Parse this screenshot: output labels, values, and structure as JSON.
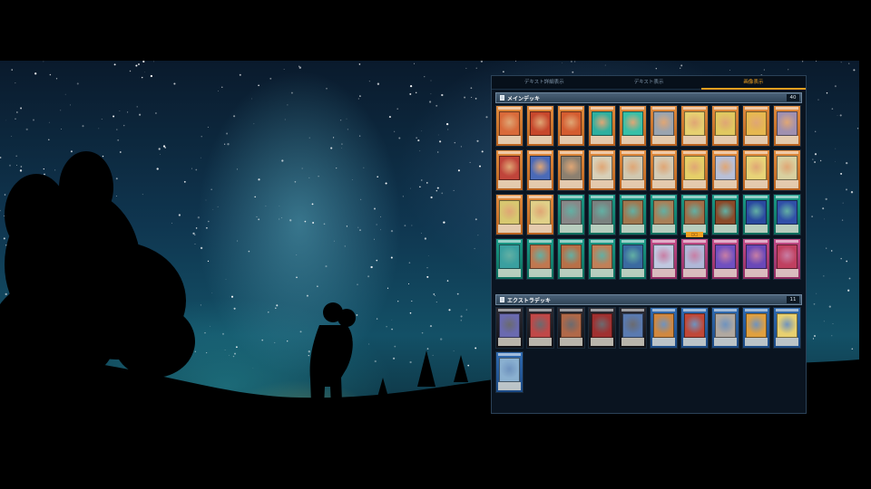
{
  "tabs": [
    {
      "label": "デキスト詳細表示",
      "active": false
    },
    {
      "label": "デキスト表示",
      "active": false
    },
    {
      "label": "画像表示",
      "active": true
    }
  ],
  "main_deck": {
    "title": "メインデッキ",
    "count": "40",
    "cards": [
      {
        "type": "effect",
        "art": "#d96a3a"
      },
      {
        "type": "effect",
        "art": "#c7472c"
      },
      {
        "type": "effect",
        "art": "#d45c30"
      },
      {
        "type": "effect",
        "art": "#2fb0a0"
      },
      {
        "type": "effect",
        "art": "#36c0a8"
      },
      {
        "type": "effect",
        "art": "#9aa4b0"
      },
      {
        "type": "effect",
        "art": "#e6d070"
      },
      {
        "type": "effect",
        "art": "#e0c860"
      },
      {
        "type": "effect",
        "art": "#e6b850"
      },
      {
        "type": "effect",
        "art": "#a090b0"
      },
      {
        "type": "effect",
        "art": "#c0443a"
      },
      {
        "type": "effect",
        "art": "#4a6ab8"
      },
      {
        "type": "effect",
        "art": "#8c8070"
      },
      {
        "type": "effect",
        "art": "#d8d0b8"
      },
      {
        "type": "effect",
        "art": "#d0c8b0"
      },
      {
        "type": "effect",
        "art": "#d4cbb5"
      },
      {
        "type": "effect",
        "art": "#e6d068"
      },
      {
        "type": "effect",
        "art": "#b8c0d8"
      },
      {
        "type": "effect",
        "art": "#e8d478"
      },
      {
        "type": "effect",
        "art": "#d8d0a0"
      },
      {
        "type": "effect",
        "art": "#d8c870"
      },
      {
        "type": "effect",
        "art": "#e0d088"
      },
      {
        "type": "spell",
        "art": "#888888"
      },
      {
        "type": "spell",
        "art": "#7a8280"
      },
      {
        "type": "spell",
        "art": "#a07850"
      },
      {
        "type": "spell",
        "art": "#a88058"
      },
      {
        "type": "spell",
        "art": "#a06e48",
        "badge": "□□"
      },
      {
        "type": "spell",
        "art": "#8a4a2a"
      },
      {
        "type": "spell",
        "art": "#2a4aa0"
      },
      {
        "type": "spell",
        "art": "#3050a8"
      },
      {
        "type": "spell",
        "art": "#3aa0a0"
      },
      {
        "type": "spell",
        "art": "#c07850"
      },
      {
        "type": "spell",
        "art": "#b87048"
      },
      {
        "type": "spell",
        "art": "#c08058"
      },
      {
        "type": "spell",
        "art": "#3a6aa0"
      },
      {
        "type": "trap",
        "art": "#c0c8e0"
      },
      {
        "type": "trap",
        "art": "#b0b8d8"
      },
      {
        "type": "trap",
        "art": "#7050c0"
      },
      {
        "type": "trap",
        "art": "#6a48b8"
      },
      {
        "type": "trap",
        "art": "#c04060"
      }
    ]
  },
  "extra_deck": {
    "title": "エクストラデッキ",
    "count": "11",
    "cards": [
      {
        "type": "xyz",
        "art": "#6a6ab0"
      },
      {
        "type": "xyz",
        "art": "#c04848"
      },
      {
        "type": "xyz",
        "art": "#b06848"
      },
      {
        "type": "xyz",
        "art": "#a03030"
      },
      {
        "type": "xyz",
        "art": "#5a7ab0"
      },
      {
        "type": "link",
        "art": "#d08840"
      },
      {
        "type": "link",
        "art": "#c04838"
      },
      {
        "type": "link",
        "art": "#b0a8a0"
      },
      {
        "type": "link",
        "art": "#e0a040"
      },
      {
        "type": "link",
        "art": "#e8d070"
      },
      {
        "type": "link",
        "art": "#8ab0d0"
      }
    ]
  },
  "colors": {
    "accent": "#f0a020",
    "panel_bg": "#0a1420"
  }
}
